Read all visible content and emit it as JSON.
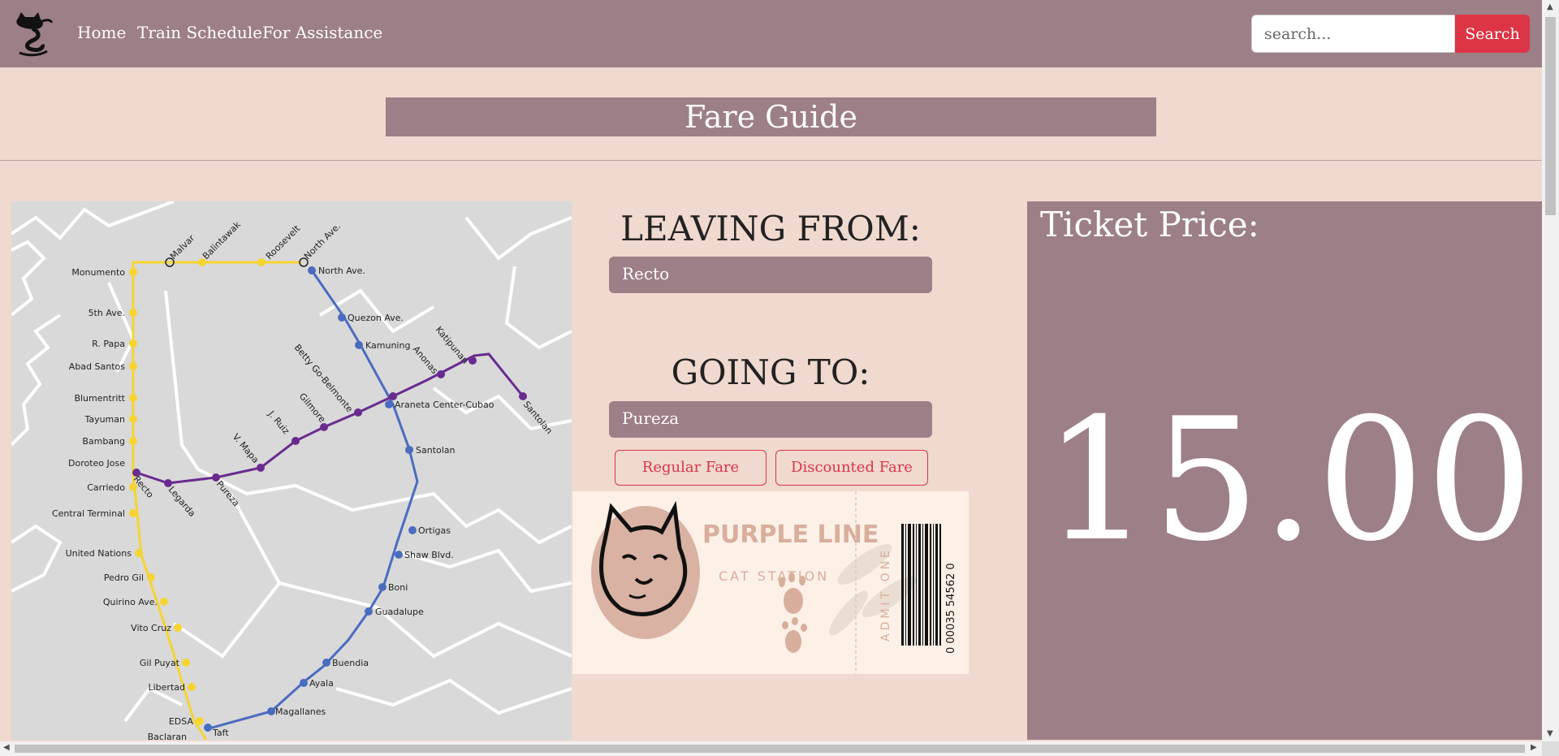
{
  "nav": {
    "links": [
      "Home",
      "Train Schedule",
      "For Assistance"
    ],
    "search_placeholder": "search...",
    "search_button": "Search"
  },
  "page": {
    "title": "Fare Guide"
  },
  "form": {
    "leaving_label": "LEAVING FROM:",
    "leaving_value": "Recto",
    "going_label": "GOING TO:",
    "going_value": "Pureza",
    "regular_fare": "Regular Fare",
    "discounted_fare": "Discounted Fare"
  },
  "ticket": {
    "line": "PURPLE LINE",
    "station": "CAT STATION",
    "admit": "ADMIT ONE",
    "barcode_number": "0 00035 54562 0"
  },
  "price": {
    "label": "Ticket Price:",
    "value": "15.00"
  },
  "map": {
    "yellow_stations": [
      "Monumento",
      "5th Ave.",
      "R. Papa",
      "Abad Santos",
      "Blumentritt",
      "Tayuman",
      "Bambang",
      "Doroteo Jose",
      "Carriedo",
      "Central Terminal",
      "United Nations",
      "Pedro Gil",
      "Quirino Ave.",
      "Vito Cruz",
      "Gil Puyat",
      "Libertad",
      "EDSA",
      "Baclaran"
    ],
    "top_stations": [
      "Malvar",
      "Balintawak",
      "Roosevelt",
      "North Ave."
    ],
    "blue_stations": [
      "North Ave.",
      "Quezon Ave.",
      "Kamuning",
      "Araneta Center-Cubao",
      "Santolan",
      "Ortigas",
      "Shaw Blvd.",
      "Boni",
      "Guadalupe",
      "Buendia",
      "Ayala",
      "Magallanes",
      "Taft"
    ],
    "purple_stations": [
      "Recto",
      "Legarda",
      "Pureza",
      "V. Mapa",
      "J. Ruiz",
      "Gilmore",
      "Betty Go-Belmonte",
      "Anonas",
      "Katipunan",
      "Santolan"
    ],
    "colors": {
      "yellow": "#f5d431",
      "blue": "#4a6cc0",
      "purple": "#6a2b8f",
      "land": "#d9d9d9",
      "roads": "#ffffff"
    }
  },
  "colors": {
    "nav": "#9d7f87",
    "bg": "#f0d9cf",
    "accent": "#dc3545"
  }
}
